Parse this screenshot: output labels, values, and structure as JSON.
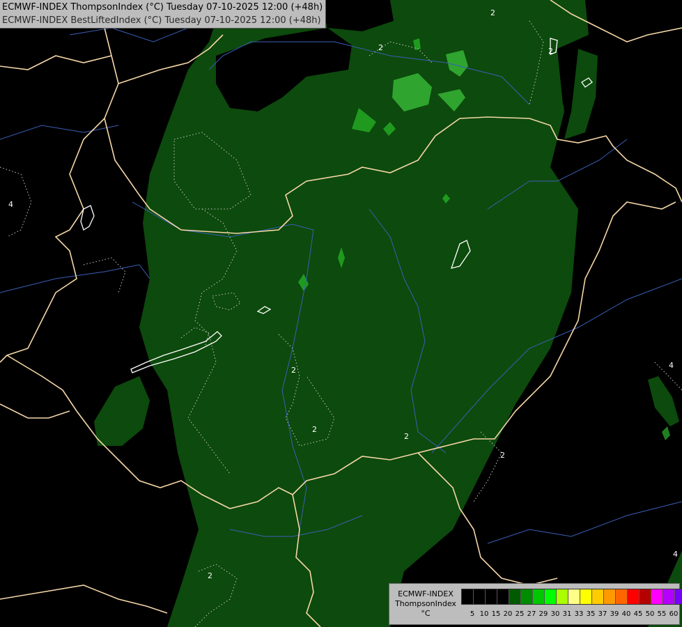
{
  "header": {
    "line1": "ECMWF-INDEX ThompsonIndex (°C) Tuesday 07-10-2025 12:00 (+48h)",
    "line2": "ECMWF-INDEX BestLiftedIndex (°C) Tuesday 07-10-2025 12:00 (+48h)"
  },
  "legend": {
    "title_line1": "ECMWF-INDEX",
    "title_line2": "ThompsonIndex",
    "unit": "°C",
    "swatches": [
      "#000000",
      "#000000",
      "#000000",
      "#000000",
      "#005a00",
      "#008c00",
      "#00c800",
      "#00ff00",
      "#aaff00",
      "#ffff88",
      "#ffff00",
      "#ffcc00",
      "#ff9900",
      "#ff6600",
      "#ff0000",
      "#b40000",
      "#ff00ff",
      "#b400ff",
      "#7800ff",
      "#0000ff"
    ],
    "ticks": [
      "5",
      "10",
      "15",
      "20",
      "25",
      "27",
      "29",
      "30",
      "31",
      "33",
      "35",
      "37",
      "39",
      "40",
      "45",
      "50",
      "55",
      "60"
    ]
  },
  "map": {
    "field_colors": {
      "ti_20_25": "#0d4a0d",
      "ti_25_27": "#1f7f1f",
      "ti_27_29": "#2fa52f",
      "border": "#f5d7a8",
      "river": "#3a5fb8",
      "contour": "#bfbfbf",
      "lake_outline": "#ffffff"
    },
    "contour_labels": [
      "2",
      "2",
      "2",
      "2",
      "2",
      "2",
      "2",
      "2",
      "4",
      "4",
      "4"
    ]
  }
}
